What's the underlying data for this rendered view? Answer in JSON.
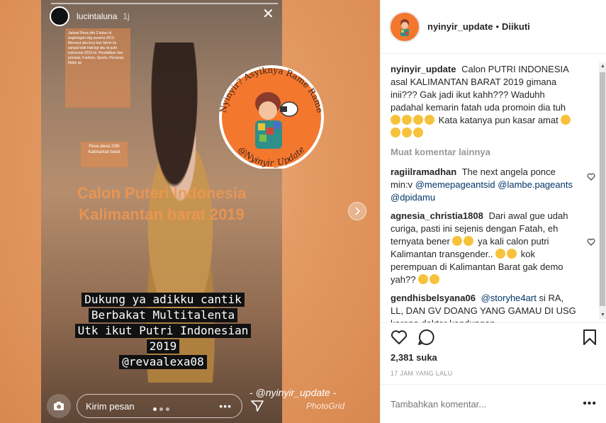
{
  "media": {
    "story": {
      "username": "lucintaluna",
      "time": "1j",
      "note_text": "Jadwal Reva dlm 2 bulan di angkringan sbg peserta 2019. Menurut aku lucu kan fahrin itu sangat baik hati bgt aku di putri indonesia 2019 ini. Pendidikan dan prestasi, Fashion, Sports, Personal, Make up",
      "reva_text": "Reva alexa 23th Kalimantan barat",
      "overlay_title": "Calon Puteri Indonesia Kalimantan barat 2019",
      "caption_lines": [
        "Dukung ya adikku cantik",
        "Berbakat Multitalenta",
        "Utk ikut Putri Indonesian",
        "2019",
        "@revaalexa08"
      ],
      "message_placeholder": "Kirim pesan",
      "more_label": "•••"
    },
    "badge": {
      "top_text": "Nyinyir? Asyiknya Rame Rame",
      "bottom_text": "@Nyinyir_Update",
      "color": "#f4772e"
    },
    "watermark": "- @nyinyir_update -",
    "watermark2": "PhotoGrid"
  },
  "post": {
    "header": {
      "username": "nyinyir_update",
      "dot": "•",
      "follow_status": "Diikuti"
    },
    "caption": {
      "username": "nyinyir_update",
      "text_1": "Calon PUTRI INDONESIA asal KALIMANTAN BARAT 2019 gimana inii??? Gak jadi ikut kahh??? Waduhh padahal kemarin fatah uda promoin dia tuh",
      "text_2": "Kata katanya pun kasar amat"
    },
    "more_comments": "Muat komentar lainnya",
    "comments": [
      {
        "username": "ragiilramadhan",
        "text": "The next angela ponce min:v",
        "mentions": [
          "@memepageantsid",
          "@lambe.pageants",
          "@dpidamu"
        ]
      },
      {
        "username": "agnesia_christia1808",
        "text_1": "Dari awal gue udah curiga, pasti ini sejenis dengan Fatah, eh ternyata bener",
        "text_2": "ya kali calon putri Kalimantan transgender..",
        "text_3": "kok perempuan di Kalimantan Barat gak demo yah??"
      },
      {
        "username": "gendhisbelsyana06",
        "mention": "@storyhe4art",
        "text": "si RA, LL, DAN GV DOANG YANG GAMAU DI USG karena dokter kandungan"
      }
    ],
    "likes": "2,381 suka",
    "time_ago": "17 JAM YANG LALU",
    "add_comment_placeholder": "Tambahkan komentar...",
    "add_comment_more": "•••"
  }
}
